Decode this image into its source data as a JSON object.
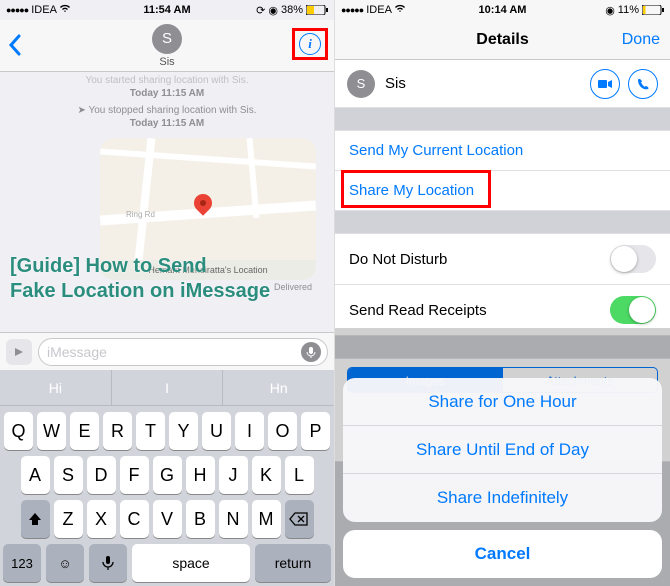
{
  "left": {
    "status": {
      "carrier": "IDEA",
      "time": "11:54 AM",
      "battery": "38%"
    },
    "contact": {
      "initial": "S",
      "name": "Sis"
    },
    "notices": [
      {
        "text": "You started sharing location with Sis.",
        "time": "Today 11:15 AM"
      },
      {
        "text": "You stopped sharing location with Sis.",
        "time": "Today 11:15 AM"
      }
    ],
    "map": {
      "road": "Ring Rd",
      "caption": "Hemant Mendiratta's Location"
    },
    "delivered": "Delivered",
    "input": {
      "placeholder": "iMessage"
    },
    "predict": [
      "Hi",
      "I",
      "Hn"
    ],
    "rows": {
      "r1": [
        "Q",
        "W",
        "E",
        "R",
        "T",
        "Y",
        "U",
        "I",
        "O",
        "P"
      ],
      "r2": [
        "A",
        "S",
        "D",
        "F",
        "G",
        "H",
        "J",
        "K",
        "L"
      ],
      "r3": [
        "Z",
        "X",
        "C",
        "V",
        "B",
        "N",
        "M"
      ]
    },
    "fn": {
      "num": "123",
      "space": "space",
      "return": "return"
    }
  },
  "right": {
    "status": {
      "carrier": "IDEA",
      "time": "10:14 AM",
      "battery": "11%"
    },
    "title": "Details",
    "done": "Done",
    "contact": {
      "initial": "S",
      "name": "Sis"
    },
    "cells": {
      "send_current": "Send My Current Location",
      "share": "Share My Location",
      "dnd": "Do Not Disturb",
      "receipts": "Send Read Receipts"
    },
    "seg": {
      "a": "Images",
      "b": "Attachments"
    },
    "sheet": {
      "opt1": "Share for One Hour",
      "opt2": "Share Until End of Day",
      "opt3": "Share Indefinitely",
      "cancel": "Cancel"
    }
  },
  "overlay": {
    "l1": "[Guide] How to Send",
    "l2": "Fake Location on iMessage"
  }
}
